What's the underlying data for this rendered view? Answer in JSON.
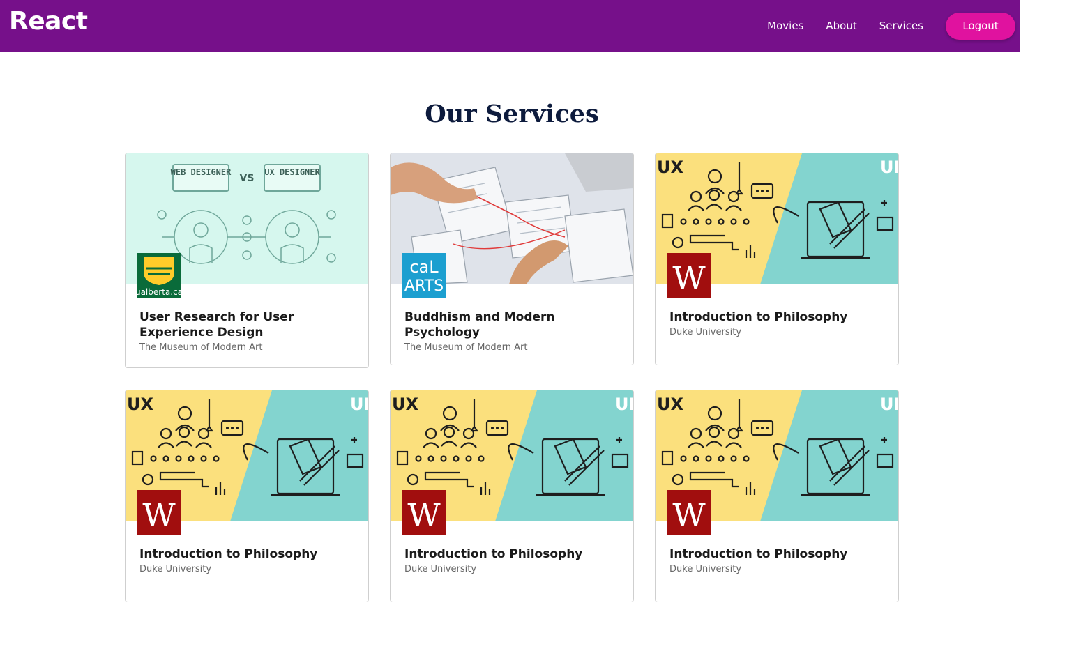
{
  "navbar": {
    "brand": "React",
    "links": [
      "Movies",
      "About",
      "Services"
    ],
    "logout_label": "Logout",
    "background": "#76108a",
    "logout_color": "#e0129f"
  },
  "page": {
    "title": "Our Services"
  },
  "cards": [
    {
      "title": "User Research for User Experience Design",
      "subtitle": "The Museum of Modern Art",
      "image": "web-vs-ux-designer-illustration",
      "logo": "ualberta-logo",
      "logo_text": "ualberta.ca",
      "image_text": {
        "left_box": "WEB DESIGNER",
        "vs": "VS",
        "right_box": "UX DESIGNER"
      }
    },
    {
      "title": "Buddhism and Modern Psychology",
      "subtitle": "The Museum of Modern Art",
      "image": "wireframe-sketch-photo",
      "logo": "calarts-logo",
      "logo_text_top": "caL",
      "logo_text_bottom": "ARTS"
    },
    {
      "title": "Introduction to Philosophy",
      "subtitle": "Duke University",
      "image": "ux-ui-illustration",
      "logo": "wesleyan-w-logo",
      "logo_text": "W",
      "image_text": {
        "left": "UX",
        "right": "UI"
      }
    },
    {
      "title": "Introduction to Philosophy",
      "subtitle": "Duke University",
      "image": "ux-ui-illustration",
      "logo": "wesleyan-w-logo",
      "logo_text": "W",
      "image_text": {
        "left": "UX",
        "right": "UI"
      }
    },
    {
      "title": "Introduction to Philosophy",
      "subtitle": "Duke University",
      "image": "ux-ui-illustration",
      "logo": "wesleyan-w-logo",
      "logo_text": "W",
      "image_text": {
        "left": "UX",
        "right": "UI"
      }
    },
    {
      "title": "Introduction to Philosophy",
      "subtitle": "Duke University",
      "image": "ux-ui-illustration",
      "logo": "wesleyan-w-logo",
      "logo_text": "W",
      "image_text": {
        "left": "UX",
        "right": "UI"
      }
    }
  ]
}
